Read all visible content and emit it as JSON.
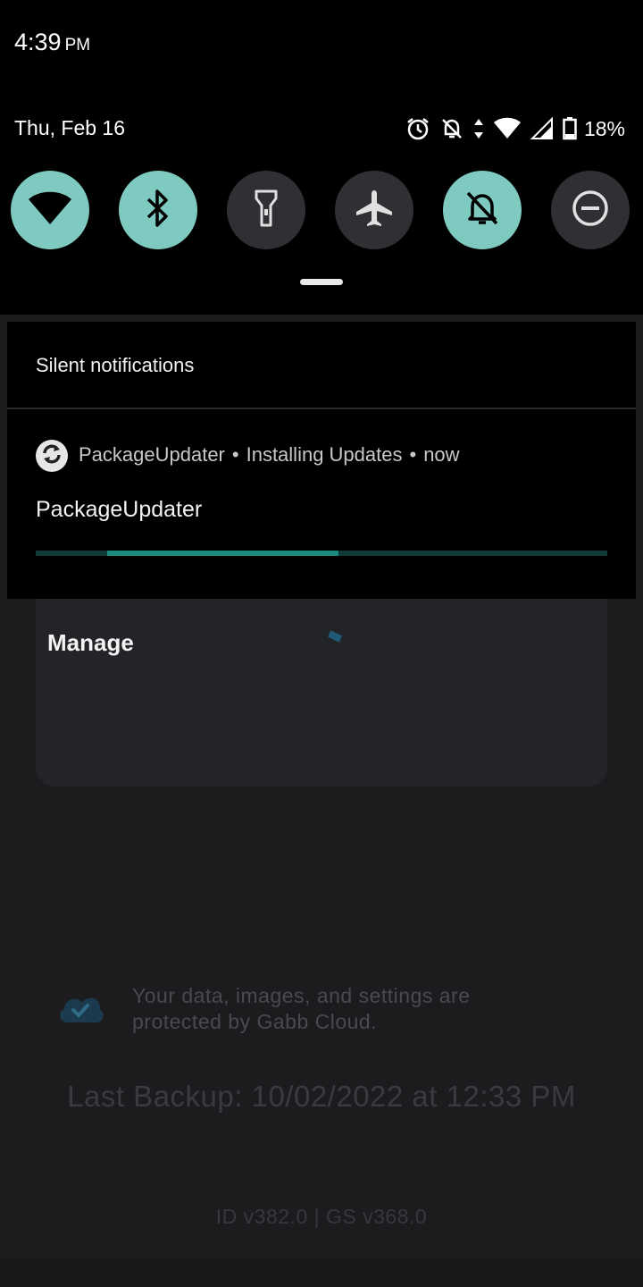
{
  "status_bar": {
    "time": "4:39",
    "ampm": "PM",
    "date": "Thu, Feb 16",
    "battery_percent": "18%"
  },
  "quick_settings": [
    {
      "name": "wifi",
      "on": true,
      "icon": "wifi-icon"
    },
    {
      "name": "bluetooth",
      "on": true,
      "icon": "bluetooth-icon"
    },
    {
      "name": "flashlight",
      "on": false,
      "icon": "flashlight-icon"
    },
    {
      "name": "airplane",
      "on": false,
      "icon": "airplane-icon"
    },
    {
      "name": "silent",
      "on": true,
      "icon": "bell-off-icon"
    },
    {
      "name": "do-not-disturb",
      "on": false,
      "icon": "dnd-icon"
    }
  ],
  "notifications": {
    "section_title": "Silent notifications",
    "item": {
      "app": "PackageUpdater",
      "channel": "Installing Updates",
      "time": "now",
      "title": "PackageUpdater",
      "progress_start": 0.125,
      "progress_end": 0.53
    }
  },
  "app": {
    "manage_title": "Manage",
    "cloud_text": "Your data, images, and settings are protected by Gabb Cloud.",
    "last_backup": "Last Backup: 10/02/2022 at 12:33 PM",
    "version": "ID v382.0 | GS v368.0"
  },
  "colors": {
    "accent": "#7fcac0",
    "progress": "#1b8c7c"
  }
}
